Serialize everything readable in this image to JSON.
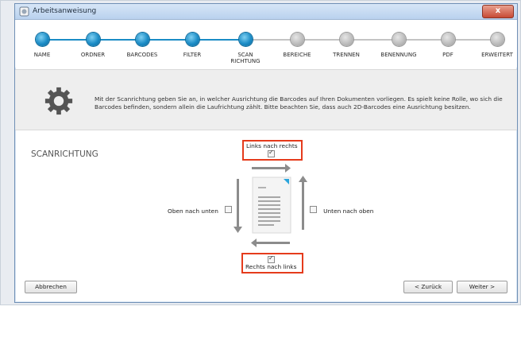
{
  "window": {
    "title": "Arbeitsanweisung",
    "close_glyph": "x"
  },
  "steps": [
    {
      "label": "NAME",
      "done": true
    },
    {
      "label": "ORDNER",
      "done": true
    },
    {
      "label": "BARCODES",
      "done": true
    },
    {
      "label": "FILTER",
      "done": true
    },
    {
      "label": "SCAN\nRICHTUNG",
      "done": true
    },
    {
      "label": "BEREICHE",
      "done": false
    },
    {
      "label": "TRENNEN",
      "done": false
    },
    {
      "label": "BENENNUNG",
      "done": false
    },
    {
      "label": "PDF",
      "done": false
    },
    {
      "label": "ERWEITERT",
      "done": false
    }
  ],
  "info": {
    "text": "Mit der Scanrichtung geben Sie an, in welcher Ausrichtung die Barcodes auf Ihren Dokumenten vorliegen. Es spielt keine Rolle, wo sich die Barcodes befinden, sondern allein die Laufrichtung zählt. Bitte beachten Sie, dass auch 2D-Barcodes eine Ausrichtung besitzen."
  },
  "section": {
    "title": "SCANRICHTUNG"
  },
  "options": {
    "left_to_right": {
      "label": "Links nach rechts",
      "checked": true
    },
    "right_to_left": {
      "label": "Rechts nach links",
      "checked": true
    },
    "top_to_bottom": {
      "label": "Oben nach unten",
      "checked": false
    },
    "bottom_to_top": {
      "label": "Unten nach oben",
      "checked": false
    }
  },
  "buttons": {
    "cancel": "Abbrechen",
    "back": "< Zurück",
    "next": "Weiter >"
  },
  "colors": {
    "accent": "#1b8cc6",
    "highlight_box": "#e53b1c",
    "arrow": "#8c8c8c"
  }
}
